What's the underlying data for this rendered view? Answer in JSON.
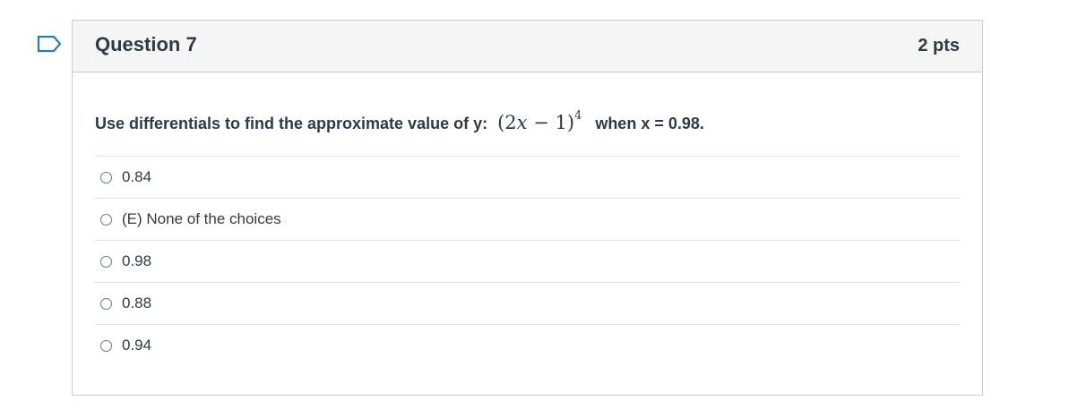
{
  "question": {
    "title": "Question 7",
    "points": "2 pts",
    "text_prefix": "Use differentials to find the approximate value of y:",
    "math": {
      "open": "(2",
      "var": "x",
      "rest": " − 1)",
      "exponent": "4"
    },
    "text_suffix": "when x = 0.98.",
    "answers": [
      {
        "label": "0.84"
      },
      {
        "label": "(E) None of the choices"
      },
      {
        "label": "0.98"
      },
      {
        "label": "0.88"
      },
      {
        "label": "0.94"
      }
    ]
  },
  "colors": {
    "flag": "#2b7abc",
    "header_bg": "#f5f5f5",
    "border": "#c7cdd1",
    "text": "#2d3b45"
  }
}
